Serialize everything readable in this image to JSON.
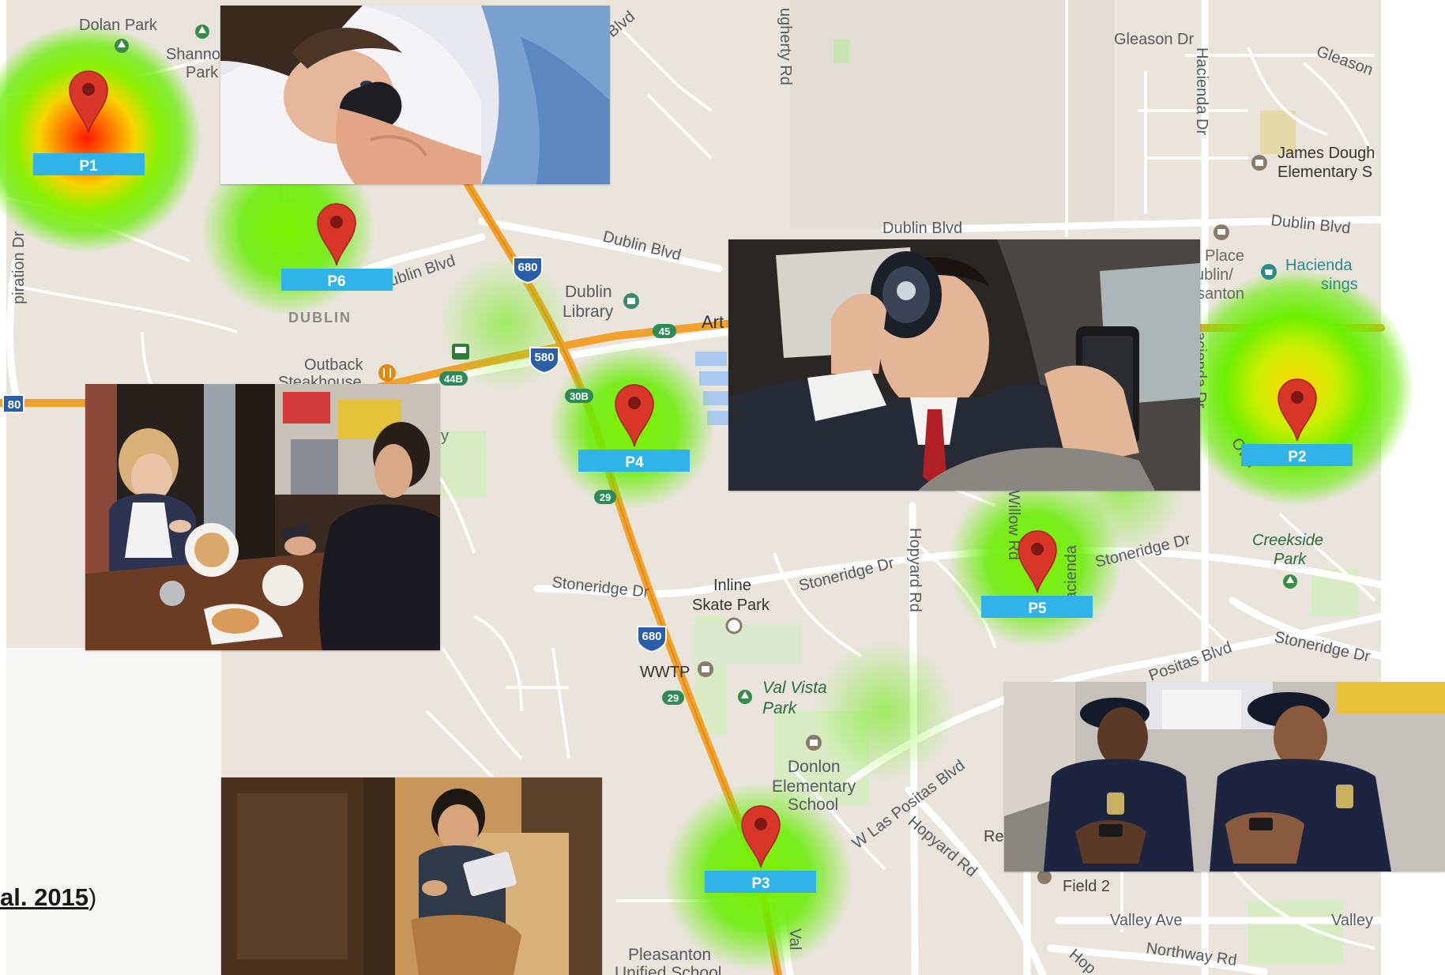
{
  "map": {
    "places": {
      "dolan_park": "Dolan Park",
      "shannon_park_1": "Shanno",
      "shannon_park_2": "Park",
      "dublin_city": "DUBLIN",
      "outback_1": "Outback",
      "outback_2": "Steakhouse",
      "dublin_library_1": "Dublin",
      "dublin_library_2": "Library",
      "art": "Art",
      "inline_skate_1": "Inline",
      "inline_skate_2": "Skate Park",
      "wwtp": "WWTP",
      "val_vista_1": "Val Vista",
      "val_vista_2": "Park",
      "donlon_1": "Donlon",
      "donlon_2": "Elementary",
      "donlon_3": "School",
      "pleasanton_1": "Pleasanton",
      "pleasanton_2": "Unified School",
      "creekside_1": "Creekside",
      "creekside_2": "Park",
      "james_1": "James Dough",
      "james_2": "Elementary S",
      "place_1": "Place",
      "place_2": "ublin/",
      "place_3": "santon",
      "hacienda_cross_1": "Hacienda",
      "hacienda_cross_2": "sings",
      "field2": "Field 2",
      "rec": "Rec",
      "y_frag": "y"
    },
    "roads": {
      "gleason_dr": "Gleason Dr",
      "gleason_right": "Gleason",
      "hacienda_dr": "Hacienda Dr",
      "hacienda_dr_lower": "acienda Dr",
      "hacienda_bottom": "acienda",
      "dublin_blvd_top": "Dublin Blvd",
      "dublin_blvd_right": "Dublin Blvd",
      "dublin_blvd_diag": "Dublin Blvd",
      "dublin_blvd_left": "ublin Blvd",
      "blvd_top": "Blvd",
      "dougherty_rd": "ugherty Rd",
      "stoneridge_left": "Stoneridge Dr",
      "stoneridge_mid": "Stoneridge Dr",
      "stoneridge_right": "Stoneridge Dr",
      "stoneridge_far": "Stoneridge Dr",
      "hopyard_rd": "Hopyard Rd",
      "hopyard_rd_lower": "Hopyard Rd",
      "willow_rd": "Willow Rd",
      "w_las_positas": "W Las Positas Blvd",
      "positas_blvd": "Positas Blvd",
      "valley_ave": "Valley Ave",
      "valley_right": "Valley",
      "northway_rd": "Northway Rd",
      "owens": "Owe",
      "inspiration_dr": "piration Dr",
      "hop_frag": "Hop",
      "ala_frag": "Val"
    },
    "shields": {
      "i680_a": "680",
      "i580": "580",
      "i680_b": "680",
      "i80": "80",
      "exit45": "45",
      "exit44b": "44B",
      "exit30b": "30B",
      "exit29a": "29",
      "exit29b": "29"
    },
    "markers": [
      {
        "label": "P1"
      },
      {
        "label": "P2"
      },
      {
        "label": "P3"
      },
      {
        "label": "P4"
      },
      {
        "label": "P5"
      },
      {
        "label": "P6"
      }
    ],
    "photos": [
      {
        "name": "person-in-bed-with-phone"
      },
      {
        "name": "restaurant-diners-on-phones"
      },
      {
        "name": "driver-drinking-and-texting"
      },
      {
        "name": "person-on-toilet-with-tablet"
      },
      {
        "name": "police-officers-on-phones"
      }
    ],
    "colors": {
      "map_bg": "#e9e5dc",
      "freeway": "#f2a22c",
      "marker_red": "#d9362a",
      "label_blue": "#2fb3e8",
      "heat_green": "#66ee00"
    }
  },
  "citation": {
    "visible": "al. 2015",
    "close": ")"
  }
}
